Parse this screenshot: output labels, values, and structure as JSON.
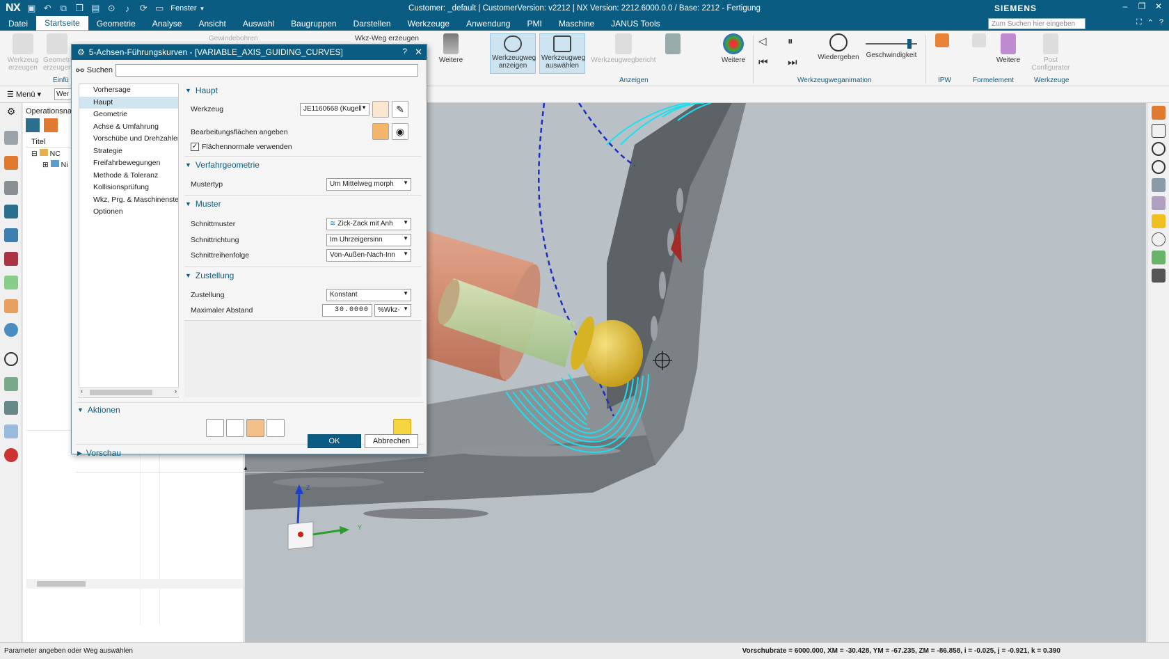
{
  "app": {
    "logo": "NX",
    "window_title": "Customer: _default | CustomerVersion: v2212 | NX Version: 2212.6000.0.0 / Base: 2212 - Fertigung",
    "vendor": "SIEMENS",
    "fenster_label": "Fenster"
  },
  "menu": {
    "items": [
      "Datei",
      "Startseite",
      "Geometrie",
      "Analyse",
      "Ansicht",
      "Auswahl",
      "Baugruppen",
      "Darstellen",
      "Werkzeuge",
      "Anwendung",
      "PMI",
      "Maschine",
      "JANUS Tools"
    ],
    "active": "Startseite",
    "search_placeholder": "Zum Suchen hier eingeben"
  },
  "ribbon": {
    "werkzeug_erzeugen": "Werkzeug erzeugen",
    "geometrie_erzeugen": "Geometrie erzeugen",
    "gewindebohren": "Gewindebohren",
    "wkz_weg_erzeugen": "Wkz-Weg erzeugen",
    "weitere1": "Weitere",
    "werkzeugweg_anzeigen": "Werkzeugweg anzeigen",
    "werkzeugweg_auswaehlen": "Werkzeugweg auswählen",
    "werkzeugwegbericht": "Werkzeugwegbericht",
    "weitere2": "Weitere",
    "wiedergeben": "Wiedergeben",
    "geschwindigkeit": "Geschwindigkeit",
    "weitere3": "Weitere",
    "post_configurator": "Post Configurator",
    "groups": {
      "einfuegen": "Einfü",
      "anzeigen": "Anzeigen",
      "animation": "Werkzeugweganimation",
      "ipw": "IPW",
      "formelement": "Formelement",
      "werkzeuge": "Werkzeuge"
    }
  },
  "toolbar2": {
    "menu_label": "Menü",
    "filter_value": "Wer"
  },
  "navigator": {
    "header": "Operationsnav",
    "col_title": "Titel",
    "rows": [
      "NC",
      "Ni"
    ]
  },
  "dialog": {
    "title": "5-Achsen-Führungskurven - [VARIABLE_AXIS_GUIDING_CURVES]",
    "help": "?",
    "search_label": "Suchen",
    "tree": [
      "Vorhersage",
      "Haupt",
      "Geometrie",
      "Achse & Umfahrung",
      "Vorschübe und Drehzahlen",
      "Strategie",
      "Freifahrbewegungen",
      "Methode & Toleranz",
      "Kollisionsprüfung",
      "Wkz, Prg. & Maschinenste",
      "Optionen"
    ],
    "tree_selected": "Haupt",
    "sections": {
      "haupt": "Haupt",
      "verfahrgeometrie": "Verfahrgeometrie",
      "muster": "Muster",
      "zustellung": "Zustellung",
      "aktionen": "Aktionen",
      "vorschau": "Vorschau"
    },
    "fields": {
      "werkzeug_label": "Werkzeug",
      "werkzeug_value": "JE1160668 (Kugell",
      "bearbeitungsflaechen_label": "Bearbeitungsflächen angeben",
      "flaechennormale_label": "Flächennormale verwenden",
      "flaechennormale_checked": true,
      "mustertyp_label": "Mustertyp",
      "mustertyp_value": "Um Mittelweg morph",
      "schnittmuster_label": "Schnittmuster",
      "schnittmuster_value": "Zick-Zack mit Anh",
      "schnittrichtung_label": "Schnittrichtung",
      "schnittrichtung_value": "Im Uhrzeigersinn",
      "schnittreihenfolge_label": "Schnittreihenfolge",
      "schnittreihenfolge_value": "Von-Außen-Nach-Inn",
      "zustellung_label": "Zustellung",
      "zustellung_value": "Konstant",
      "max_abstand_label": "Maximaler Abstand",
      "max_abstand_value": "30.0000",
      "max_abstand_unit": "%Wkz-"
    },
    "ok": "OK",
    "cancel": "Abbrechen"
  },
  "triad": {
    "z": "Z",
    "y": "Y"
  },
  "status": {
    "left": "Parameter angeben oder Weg auswählen",
    "right": "Vorschubrate = 6000.000, XM = -30.428, YM = -67.235, ZM = -86.858, i = -0.025, j = -0.921, k = 0.390"
  },
  "colors": {
    "accent": "#0a5c82",
    "toolpath": "#19e0ef",
    "tool_holder": "#d9a08a",
    "tool_ball": "#e6c21a"
  }
}
